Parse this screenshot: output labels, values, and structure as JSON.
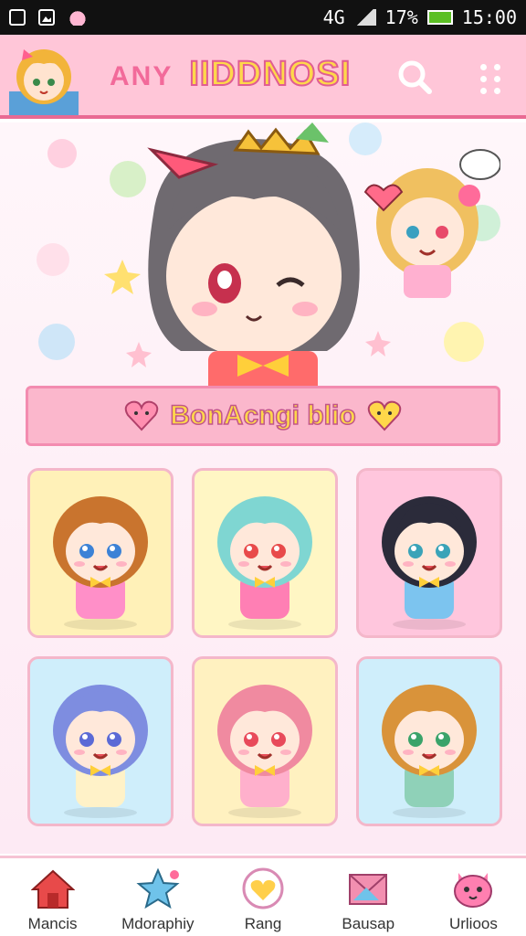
{
  "status_bar": {
    "time": "15:00",
    "battery": "17%",
    "network": "4G",
    "icons": [
      "notification-icon",
      "image-icon",
      "cat-icon"
    ]
  },
  "header": {
    "title_part1": "ANY",
    "title_part2": "IIDDNOSI",
    "search_icon": "search-icon",
    "more_icon": "grid-dots-icon"
  },
  "banner": {
    "text": "BonAcngi blio"
  },
  "cards": [
    {
      "name": "chibi-brown",
      "bg": "#fff1b8",
      "hair": "#c9742e",
      "eyes": "#3c82d6",
      "outfit": "#ff8fc8"
    },
    {
      "name": "chibi-mint",
      "bg": "#fff6c4",
      "hair": "#7fd6d2",
      "eyes": "#e84a4a",
      "outfit": "#ff7fb4"
    },
    {
      "name": "chibi-black",
      "bg": "#ffc6dd",
      "hair": "#2b2b3a",
      "eyes": "#3aa3b8",
      "outfit": "#7cc4ef"
    },
    {
      "name": "chibi-blue",
      "bg": "#cfeefb",
      "hair": "#7e8de0",
      "eyes": "#5b6ad6",
      "outfit": "#fff2c8"
    },
    {
      "name": "chibi-pink",
      "bg": "#fff1c0",
      "hair": "#f08aa0",
      "eyes": "#e84a5a",
      "outfit": "#ffb0cc"
    },
    {
      "name": "chibi-ginger",
      "bg": "#cfeefb",
      "hair": "#d9933a",
      "eyes": "#3aa36a",
      "outfit": "#8fd1b8"
    }
  ],
  "nav": [
    {
      "label": "Mancis",
      "icon": "home-icon",
      "color": "#e84a4a"
    },
    {
      "label": "Mdoraphiy",
      "icon": "star-icon",
      "color": "#6fc3ea"
    },
    {
      "label": "Rang",
      "icon": "heart-icon",
      "color": "#ffcf4a"
    },
    {
      "label": "Bausap",
      "icon": "envelope-icon",
      "color": "#f28fb0"
    },
    {
      "label": "Urlioos",
      "icon": "cat-face-icon",
      "color": "#ff7fb0"
    }
  ]
}
